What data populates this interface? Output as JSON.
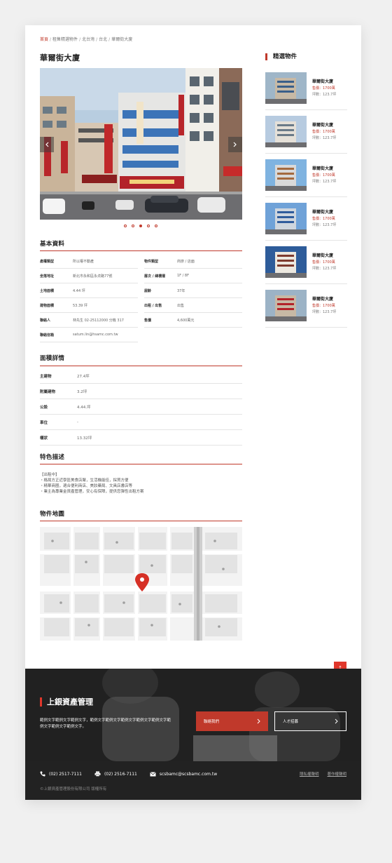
{
  "breadcrumb": {
    "home": "首頁",
    "items": [
      "租售精選物件",
      "北台灣",
      "台北",
      "華爾街大廈"
    ],
    "separator": "/"
  },
  "property": {
    "title": "華爾街大廈"
  },
  "carousel": {
    "prev_icon": "chevron-left-icon",
    "next_icon": "chevron-right-icon",
    "slide_count": 5,
    "active_index": 2
  },
  "basic_info": {
    "title": "基本資料",
    "rows": [
      [
        {
          "label": "產權類型",
          "value": "所以權不動產"
        },
        {
          "label": "物件類型",
          "value": "商辦 / 店面"
        }
      ],
      [
        {
          "label": "坐落地址",
          "value": "新北市永和區永貞路77號"
        },
        {
          "label": "層次 / 總樓層",
          "value": "1F / 8F"
        }
      ],
      [
        {
          "label": "土地面積",
          "value": "4.44 坪"
        },
        {
          "label": "屋齡",
          "value": "37年"
        }
      ],
      [
        {
          "label": "建物面積",
          "value": "53.39 坪"
        },
        {
          "label": "出租 / 出售",
          "value": "出售"
        }
      ],
      [
        {
          "label": "聯絡人",
          "value": "林先生 02-25112000 分機 317"
        },
        {
          "label": "售價",
          "value": "4,600萬元"
        }
      ],
      [
        {
          "label": "聯絡信箱",
          "value": "satum.lin@hsamc.com.tw"
        },
        {
          "label": "",
          "value": ""
        }
      ]
    ]
  },
  "area_details": {
    "title": "面積詳情",
    "rows": [
      {
        "label": "主建物",
        "value": "27.4坪"
      },
      {
        "label": "附屬建物",
        "value": "3.2坪"
      },
      {
        "label": "公設",
        "value": "4.44.坪"
      },
      {
        "label": "車位",
        "value": "-"
      },
      {
        "label": "權狀",
        "value": "13.32坪"
      }
    ]
  },
  "features": {
    "title": "特色描述",
    "lines": [
      "【出租中】",
      "・格局方正近學區美食店聚，生活機能佳，採買方便",
      "・精華商圈，適合便利商店、美妝藥局、文具店書店等",
      "・業主為專業金資產管理，安心有保障，提供您彈性出租方案"
    ]
  },
  "map": {
    "title": "物件地圖",
    "pin_icon": "map-pin-icon"
  },
  "sidebar": {
    "title": "精選物件",
    "items": [
      {
        "name": "華爾街大廈",
        "price": "售價：1700萬",
        "area": "坪數：123.7坪"
      },
      {
        "name": "華爾街大廈",
        "price": "售價：1700萬",
        "area": "坪數：123.7坪"
      },
      {
        "name": "華爾街大廈",
        "price": "售價：1700萬",
        "area": "坪數：123.7坪"
      },
      {
        "name": "華爾街大廈",
        "price": "售價：1700萬",
        "area": "坪數：123.7坪"
      },
      {
        "name": "華爾街大廈",
        "price": "售價：1700萬",
        "area": "坪數：123.7坪"
      },
      {
        "name": "華爾街大廈",
        "price": "售價：1700萬",
        "area": "坪數：123.7坪"
      }
    ]
  },
  "back_to_top": {
    "icon": "arrow-up-icon",
    "label": "↑"
  },
  "banner": {
    "title": "上銀資產管理",
    "description": "範例文字範例文字範例文字，範例文字範例文字範例文字範例文字範例文字範例文字範例文字範例文字。",
    "contact_button": "聯絡我們",
    "jobs_button": "人才招募",
    "button_icon": "chevron-right-icon"
  },
  "footer": {
    "phone": "(02) 2517-7111",
    "fax": "(02) 2516-7111",
    "email": "scsbamc@scsbamc.com.tw",
    "privacy_link": "隱私權聲明",
    "copyright_link": "著作權聲明",
    "copyright": "©上銀資產管理股份有限公司 版權所有"
  },
  "colors": {
    "accent": "#c0392b",
    "footer_bg": "#222222"
  }
}
